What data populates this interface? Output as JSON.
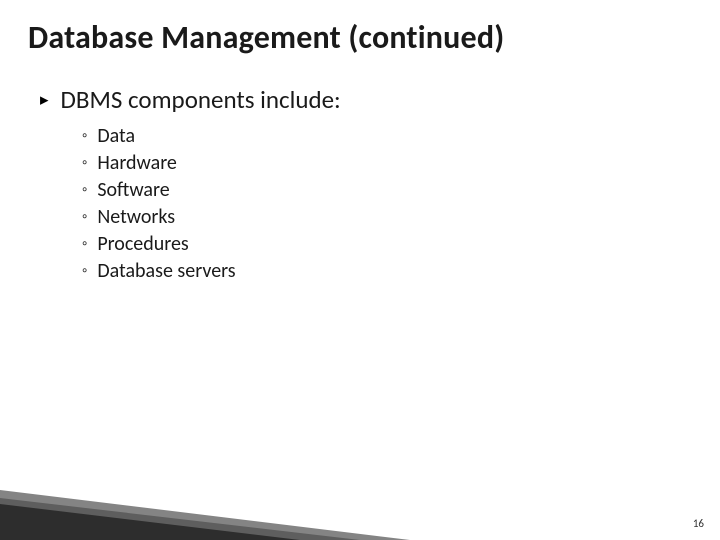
{
  "title": "Database Management (continued)",
  "heading": "DBMS components include:",
  "items": [
    "Data",
    "Hardware",
    "Software",
    "Networks",
    "Procedures",
    "Database servers"
  ],
  "page_number": "16"
}
